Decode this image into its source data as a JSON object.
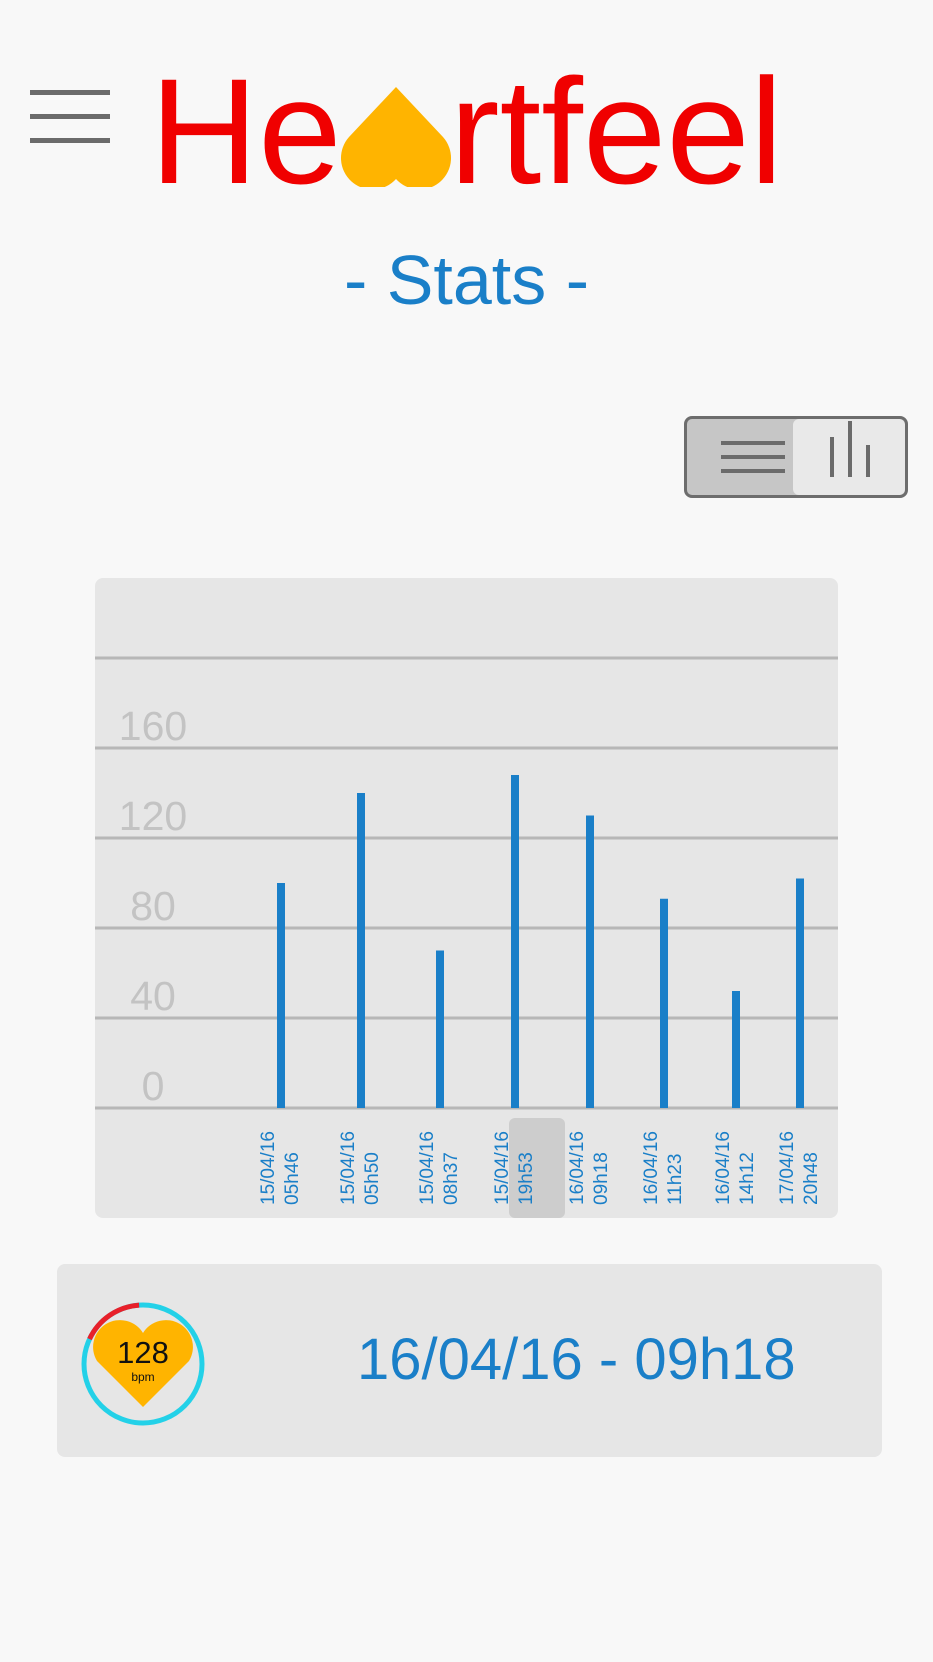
{
  "app": {
    "title_before": "He",
    "title_after": "rtfeel",
    "subtitle": "- Stats -"
  },
  "colors": {
    "brand_red": "#f00000",
    "heart_yellow": "#ffb400",
    "accent_blue": "#1a7fc8",
    "card_bg": "#e6e6e6",
    "gauge_cyan": "#23d1e8",
    "gauge_red": "#e8202a"
  },
  "icons": {
    "menu": "hamburger-menu-icon",
    "brand_heart": "heart-icon",
    "list_view": "list-icon",
    "chart_view": "bar-chart-icon"
  },
  "view_toggle": {
    "options": [
      "list",
      "chart"
    ],
    "selected": "chart"
  },
  "chart_data": {
    "type": "bar",
    "categories": [
      "15/04/16 05h46",
      "15/04/16 05h50",
      "15/04/16 08h37",
      "15/04/16 19h53",
      "16/04/16 09h18",
      "16/04/16 11h23",
      "16/04/16 14h12",
      "17/04/16 20h48"
    ],
    "category_lines": [
      [
        "15/04/16",
        "05h46"
      ],
      [
        "15/04/16",
        "05h50"
      ],
      [
        "15/04/16",
        "08h37"
      ],
      [
        "15/04/16",
        "19h53"
      ],
      [
        "16/04/16",
        "09h18"
      ],
      [
        "16/04/16",
        "11h23"
      ],
      [
        "16/04/16",
        "14h12"
      ],
      [
        "17/04/16",
        "20h48"
      ]
    ],
    "values": [
      100,
      140,
      70,
      148,
      130,
      93,
      52,
      102
    ],
    "selected_index": 4,
    "y_ticks": [
      0,
      40,
      80,
      120,
      160
    ],
    "ylim": [
      0,
      200
    ],
    "grid": true,
    "title": "",
    "xlabel": "",
    "ylabel": ""
  },
  "reading": {
    "bpm": "128",
    "unit": "bpm",
    "datetime": "16/04/16 - 09h18",
    "gauge_fraction": 0.17
  }
}
